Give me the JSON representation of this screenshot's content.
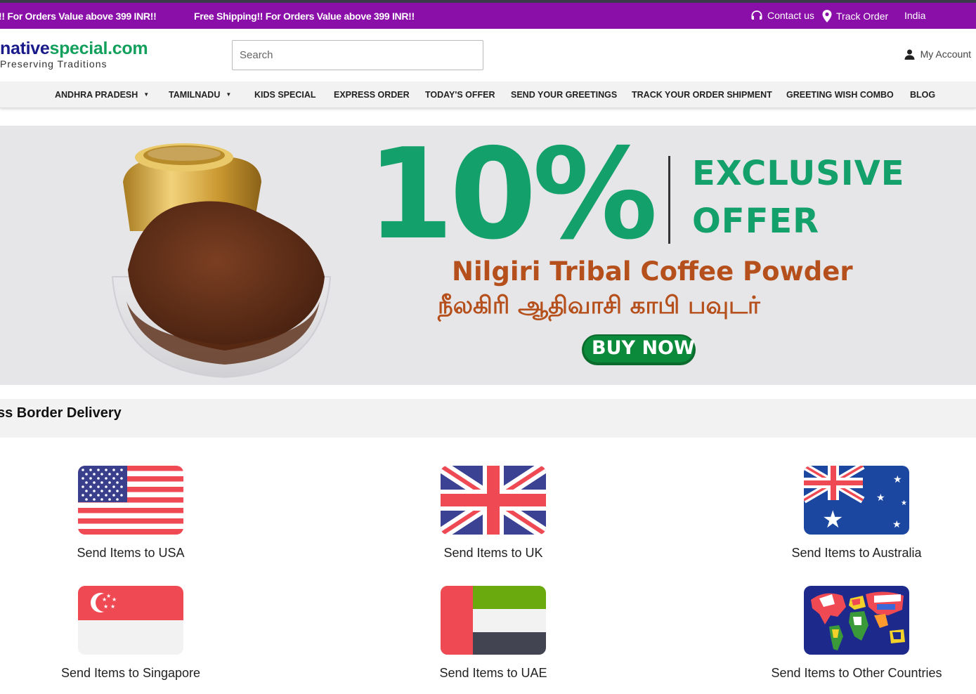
{
  "promo": {
    "message_1": "!! For Orders Value above 399 INR!!",
    "message_2": "Free Shipping!! For Orders Value above 399 INR!!"
  },
  "utility": {
    "contact": "Contact us",
    "track": "Track Order",
    "country": "India"
  },
  "logo": {
    "part1": "native",
    "part2": "special.com",
    "tagline": "Preserving Traditions"
  },
  "search": {
    "placeholder": "Search"
  },
  "account": {
    "label": "My Account"
  },
  "nav": {
    "items": [
      {
        "label": "ANDHRA PRADESH",
        "dropdown": true
      },
      {
        "label": "TAMILNADU",
        "dropdown": true
      },
      {
        "label": "KIDS SPECIAL"
      },
      {
        "label": "EXPRESS ORDER"
      },
      {
        "label": "TODAY'S OFFER"
      },
      {
        "label": "SEND YOUR GREETINGS"
      },
      {
        "label": "TRACK YOUR ORDER SHIPMENT"
      },
      {
        "label": "GREETING WISH COMBO"
      },
      {
        "label": "BLOG"
      }
    ]
  },
  "banner": {
    "percent": "10%",
    "exclusive": "EXCLUSIVE",
    "offer": "OFFER",
    "product": "Nilgiri Tribal Coffee Powder",
    "product_tamil": "நீலகிரி ஆதிவாசி காபி பவுடர்",
    "cta": "BUY NOW",
    "colors": {
      "green": "#13a06a",
      "brown": "#b5501c",
      "button": "#0a8a3a"
    }
  },
  "section": {
    "title": "ss Border Delivery"
  },
  "countries": [
    {
      "label": "Send Items to USA",
      "flag": "usa-flag"
    },
    {
      "label": "Send Items to UK",
      "flag": "uk-flag"
    },
    {
      "label": "Send Items to Australia",
      "flag": "australia-flag"
    },
    {
      "label": "Send Items to Singapore",
      "flag": "singapore-flag"
    },
    {
      "label": "Send Items to UAE",
      "flag": "uae-flag"
    },
    {
      "label": "Send Items to Other Countries",
      "flag": "world-map-flag"
    }
  ]
}
